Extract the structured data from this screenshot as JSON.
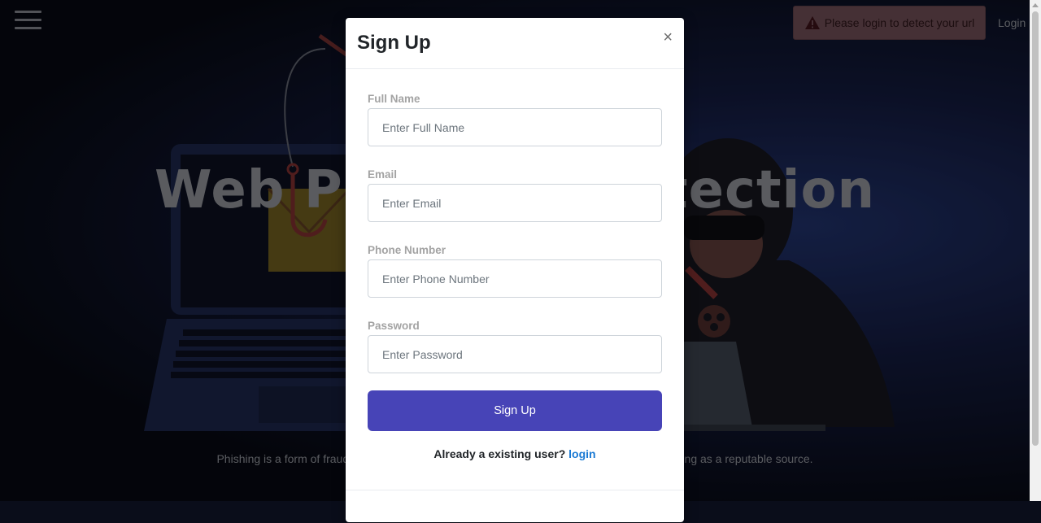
{
  "nav": {
    "menu_icon": "hamburger-icon",
    "alert_text": "Please login to detect your url",
    "alert_icon": "warning-triangle-icon",
    "login_label": "Login"
  },
  "hero": {
    "title": "Web Phishing Detection",
    "description": "Phishing is a form of fraud in which an attacker tries to obtain sensitive information while posing as a reputable source."
  },
  "modal": {
    "title": "Sign Up",
    "close_label": "×",
    "fields": [
      {
        "label": "Full Name",
        "placeholder": "Enter Full Name"
      },
      {
        "label": "Email",
        "placeholder": "Enter Email"
      },
      {
        "label": "Phone Number",
        "placeholder": "Enter Phone Number"
      },
      {
        "label": "Password",
        "placeholder": "Enter Password"
      }
    ],
    "submit_label": "Sign Up",
    "existing_text": "Already a existing user?",
    "login_link": "login"
  },
  "colors": {
    "primary_button": "#4744b7",
    "link": "#1a7ad4",
    "alert_bg": "#6b4a52"
  }
}
